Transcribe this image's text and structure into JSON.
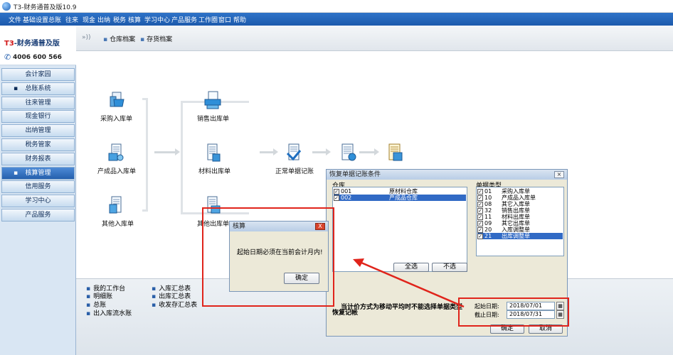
{
  "window": {
    "title": "T3-财务通普及版10.9"
  },
  "menu": [
    "文件",
    "基础设置",
    "总账",
    "往来",
    "现金",
    "出纳",
    "税务",
    "核算",
    "学习中心",
    "产品服务",
    "工作圈",
    "窗口",
    "帮助"
  ],
  "logo": {
    "brand_prefix": "T3",
    "brand_rest": "-财务通普及版",
    "phone": "4006 600 566"
  },
  "sidebar": {
    "items": [
      {
        "label": "会计家园",
        "bullet": false
      },
      {
        "label": "总账系统",
        "bullet": true
      },
      {
        "label": "往来管理",
        "bullet": false
      },
      {
        "label": "现金银行",
        "bullet": false
      },
      {
        "label": "出纳管理",
        "bullet": false
      },
      {
        "label": "税务管家",
        "bullet": false
      },
      {
        "label": "财务报表",
        "bullet": false
      },
      {
        "label": "核算管理",
        "bullet": true,
        "active": true
      },
      {
        "label": "信用服务",
        "bullet": false
      },
      {
        "label": "学习中心",
        "bullet": false
      },
      {
        "label": "产品服务",
        "bullet": false
      }
    ]
  },
  "toolbar": {
    "arrows": "»))",
    "tabs": [
      "仓库档案",
      "存货档案"
    ]
  },
  "flow": {
    "inbound": [
      "采购入库单",
      "产成品入库单",
      "其他入库单"
    ],
    "outbound": [
      "销售出库单",
      "材料出库单",
      "其他出库单"
    ],
    "posting": "正常单据记账",
    "extra1": "",
    "extra2": ""
  },
  "links": {
    "col1": [
      "我的工作台",
      "明细账",
      "总账",
      "出入库流水账"
    ],
    "col2": [
      "入库汇总表",
      "出库汇总表",
      "收发存汇总表"
    ]
  },
  "restore_dialog": {
    "title": "恢复单据记账条件",
    "warehouse_label": "仓库",
    "warehouses": [
      {
        "code": "001",
        "name": "原材料仓库",
        "checked": true,
        "selected": false
      },
      {
        "code": "002",
        "name": "产成品仓库",
        "checked": true,
        "selected": true
      }
    ],
    "doctype_label": "单据类型",
    "doctypes": [
      {
        "code": "01",
        "name": "采购入库单",
        "selected": false
      },
      {
        "code": "10",
        "name": "产成品入库单",
        "selected": false
      },
      {
        "code": "08",
        "name": "其它入库单",
        "selected": false
      },
      {
        "code": "32",
        "name": "销售出库单",
        "selected": false
      },
      {
        "code": "11",
        "name": "材料出库单",
        "selected": false
      },
      {
        "code": "09",
        "name": "其它出库单",
        "selected": false
      },
      {
        "code": "20",
        "name": "入库调整单",
        "selected": false
      },
      {
        "code": "21",
        "name": "出库调整单",
        "selected": true
      }
    ],
    "select_all": "全选",
    "select_none": "不选",
    "note": "当计价方式为移动平均时不能选择单据类型",
    "restore_label": "恢复记帐",
    "start_label": "起始日期:",
    "start_value": "2018/07/01",
    "end_label": "截止日期:",
    "end_value": "2018/07/31",
    "ok": "确定",
    "cancel": "取消"
  },
  "alert_dialog": {
    "title": "核算",
    "message": "起始日期必须在当前会计月内!",
    "ok": "确定",
    "close": "X"
  },
  "colors": {
    "menubar": "#1d5aac",
    "highlight": "#e0241b",
    "selection": "#316ac5"
  }
}
